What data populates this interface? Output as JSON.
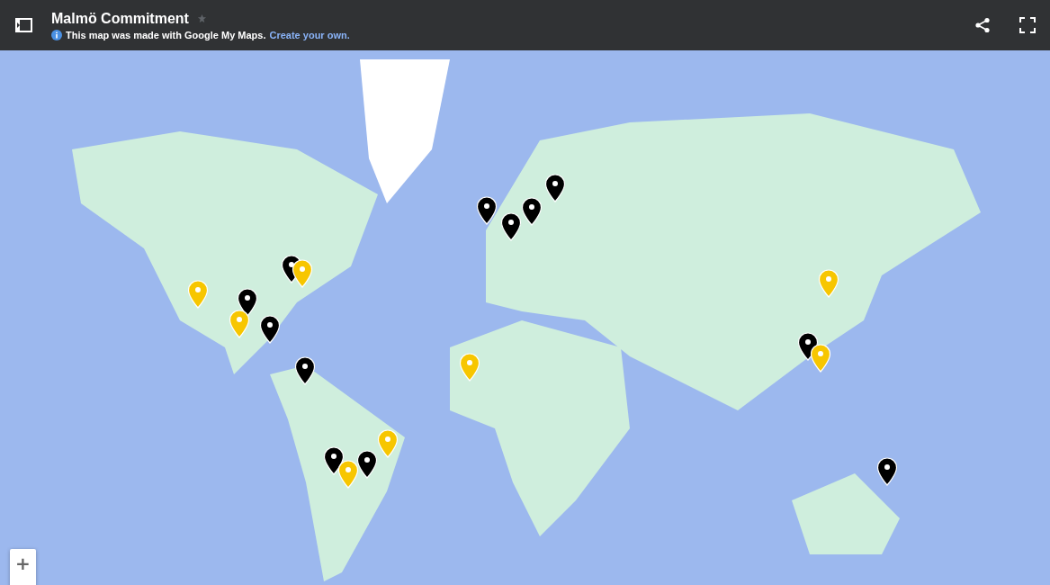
{
  "header": {
    "title": "Malmö Commitment",
    "starred": false,
    "notice": "This map was made with Google My Maps.",
    "notice_link": "Create your own."
  },
  "map": {
    "pins": [
      {
        "color": "#000000"
      },
      {
        "color": "#f7c600"
      },
      {
        "color": "#f7c600"
      },
      {
        "color": "#000000"
      },
      {
        "color": "#000000"
      },
      {
        "color": "#f7c600"
      },
      {
        "color": "#000000"
      },
      {
        "color": "#000000"
      },
      {
        "color": "#f7c600"
      },
      {
        "color": "#000000"
      },
      {
        "color": "#f7c600"
      },
      {
        "color": "#f7c600"
      },
      {
        "color": "#000000"
      },
      {
        "color": "#000000"
      },
      {
        "color": "#000000"
      },
      {
        "color": "#000000"
      },
      {
        "color": "#f7c600"
      },
      {
        "color": "#000000"
      },
      {
        "color": "#f7c600"
      },
      {
        "color": "#000000"
      }
    ],
    "zoom_in": "+"
  }
}
